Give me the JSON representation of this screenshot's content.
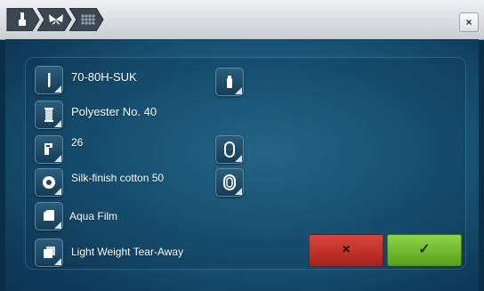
{
  "breadcrumb": {
    "items": [
      {
        "icon": "needle-icon"
      },
      {
        "icon": "butterfly-icon"
      },
      {
        "icon": "grid-icon"
      }
    ]
  },
  "window": {
    "close_label": "×"
  },
  "settings": {
    "needle": {
      "label": "70-80H-SUK",
      "icon": "needle-icon"
    },
    "thread": {
      "label": "Polyester No. 40",
      "icon": "thread-spool-icon"
    },
    "presser_foot": {
      "label": "26",
      "icon": "presser-foot-icon"
    },
    "bobbin": {
      "label": "Silk-finish cotton 50",
      "icon": "bobbin-icon"
    },
    "stabilizer_top": {
      "label": "Aqua Film",
      "icon": "stabilizer-icon"
    },
    "stabilizer_bottom": {
      "label": "Light Weight Tear-Away",
      "icon": "stabilizer-layers-icon"
    }
  },
  "side_icons": [
    "thread-info-icon",
    "hoop-icon",
    "hoop-large-icon"
  ],
  "actions": {
    "cancel_label": "×",
    "ok_label": "✓"
  },
  "colors": {
    "cancel": "#c9372d",
    "ok": "#7bc233",
    "panel": "#1d5f82"
  }
}
